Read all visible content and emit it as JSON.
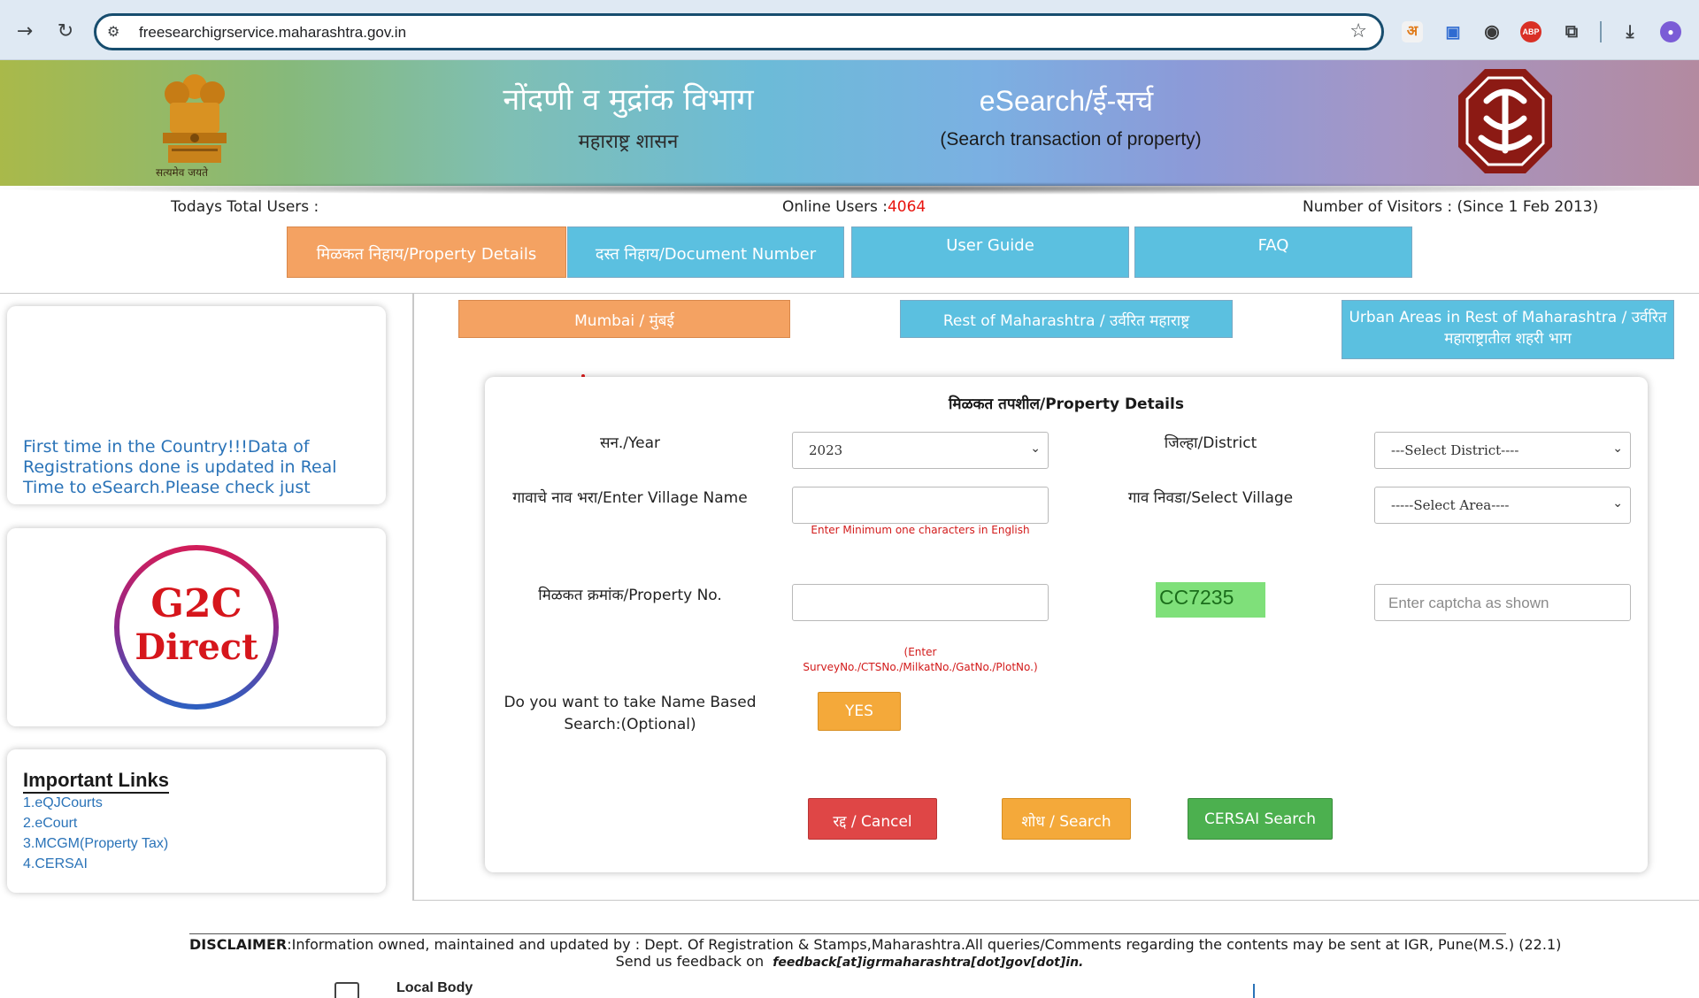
{
  "browser": {
    "url": "freesearchigrservice.maharashtra.gov.in",
    "extensions": [
      {
        "name": "translate-ext-icon",
        "label": "अ",
        "color": "#e07b1a"
      },
      {
        "name": "tab-ext-icon",
        "label": "▣",
        "color": "#2f6bd1"
      },
      {
        "name": "chrome-ext-icon",
        "label": "●",
        "color": "#3a3a3a"
      },
      {
        "name": "adblock-ext-icon",
        "label": "ABP",
        "color": "#d93025"
      },
      {
        "name": "extensions-puzzle-icon",
        "label": "⧉",
        "color": "#3c4043"
      }
    ]
  },
  "banner": {
    "dept_title": "नोंदणी व मुद्रांक विभाग",
    "dept_sub": "महाराष्ट्र शासन",
    "emblem_motto": "सत्यमेव जयते",
    "esearch_title": "eSearch/ई-सर्च",
    "esearch_sub": "(Search transaction of property)"
  },
  "stats": {
    "todays_users_label": "Todays Total Users :",
    "online_users_label": "Online Users :",
    "online_users_value": "4064",
    "visitors_label": "Number of Visitors : (Since 1 Feb 2013)"
  },
  "tabs": [
    {
      "label": "मिळकत निहाय/Property Details"
    },
    {
      "label": "दस्त निहाय/Document Number"
    },
    {
      "label": "User Guide"
    },
    {
      "label": "FAQ"
    }
  ],
  "sidebar": {
    "ticker": "First time in the Country!!!Data of Registrations done is updated in Real Time to eSearch.Please check just",
    "g2c_line1": "G2C",
    "g2c_line2": "Direct",
    "links_title": "Important Links",
    "links": [
      "1.eQJCourts",
      "2.eCourt",
      "3.MCGM(Property Tax)",
      "4.CERSAI"
    ]
  },
  "regions": [
    {
      "label": "Mumbai / मुंबई"
    },
    {
      "label": "Rest of Maharashtra / उर्वरित महाराष्ट्र"
    },
    {
      "label": "Urban Areas in Rest of Maharashtra / उर्वरित महाराष्ट्रातील शहरी भाग"
    }
  ],
  "form": {
    "title": "मिळकत तपशील/Property Details",
    "year_label": "सन./Year",
    "year_value": "2023",
    "district_label": "जिल्हा/District",
    "district_value": "---Select District----",
    "village_name_label": "गावाचे नाव भरा/Enter Village Name",
    "village_name_value": "",
    "village_hint": "Enter Minimum one characters in English",
    "select_village_label": "गाव निवडा/Select Village",
    "select_village_value": "-----Select Area----",
    "property_no_label": "मिळकत क्रमांक/Property No.",
    "property_no_value": "",
    "property_hint_line1": "(Enter",
    "property_hint_line2": "SurveyNo./CTSNo./MilkatNo./GatNo./PlotNo.)",
    "captcha_text": "CC7235",
    "captcha_placeholder": "Enter captcha as shown",
    "name_search_label_line1": "Do you want to take Name Based",
    "name_search_label_line2": "Search:(Optional)",
    "yes_button": "YES",
    "cancel_button": "रद्द / Cancel",
    "search_button": "शोध / Search",
    "cersai_button": "CERSAI Search"
  },
  "footer": {
    "disclaimer_label": "DISCLAIMER",
    "disclaimer_text": ":Information owned, maintained and updated by : Dept. Of Registration & Stamps,Maharashtra.All queries/Comments regarding the contents may be sent at IGR, Pune(M.S.) (22.1)",
    "feedback_label": "Send us feedback on",
    "feedback_email": "feedback[at]igrmaharashtra[dot]gov[dot]in.",
    "local_body": "Local Body"
  },
  "colors": {
    "orange_tab": "#f4a262",
    "blue_tab": "#5bc0e0",
    "cancel": "#df4646",
    "cersai": "#4cb04f",
    "link": "#2a73b8"
  }
}
